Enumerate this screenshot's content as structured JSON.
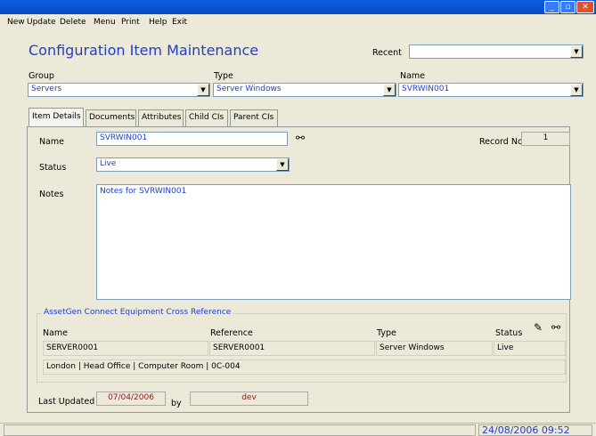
{
  "menu": [
    "New",
    "Update",
    "Delete",
    "Menu",
    "Print",
    "Help",
    "Exit"
  ],
  "header": {
    "title": "Configuration Item Maintenance",
    "recent_label": "Recent",
    "recent_value": ""
  },
  "filters": {
    "group_label": "Group",
    "group_value": "Servers",
    "type_label": "Type",
    "type_value": "Server Windows",
    "name_label": "Name",
    "name_value": "SVRWIN001"
  },
  "tabs": [
    "Item Details",
    "Documents",
    "Attributes",
    "Child CIs",
    "Parent CIs"
  ],
  "details": {
    "name_label": "Name",
    "name_value": "SVRWIN001",
    "record_label": "Record No:",
    "record_value": "1",
    "status_label": "Status",
    "status_value": "Live",
    "notes_label": "Notes",
    "notes_value": "Notes for SVRWIN001"
  },
  "cross_ref": {
    "title": "AssetGen Connect Equipment Cross Reference",
    "columns": [
      "Name",
      "Reference",
      "Type",
      "Status"
    ],
    "row": [
      "SERVER0001",
      "SERVER0001",
      "Server Windows",
      "Live"
    ],
    "location": "London | Head Office | Computer Room | 0C-004"
  },
  "footer": {
    "last_updated_label": "Last Updated",
    "last_updated_value": "07/04/2006",
    "by_label": "by",
    "by_value": "dev"
  },
  "statusbar": {
    "datetime": "24/08/2006  09:52"
  },
  "icons": {
    "binoculars": "binoculars-icon",
    "wand": "magic-wand-icon"
  },
  "colors": {
    "accent": "#1f3fc8",
    "value_red": "#8b1a1a",
    "titlebar": "#0a5fe0"
  }
}
